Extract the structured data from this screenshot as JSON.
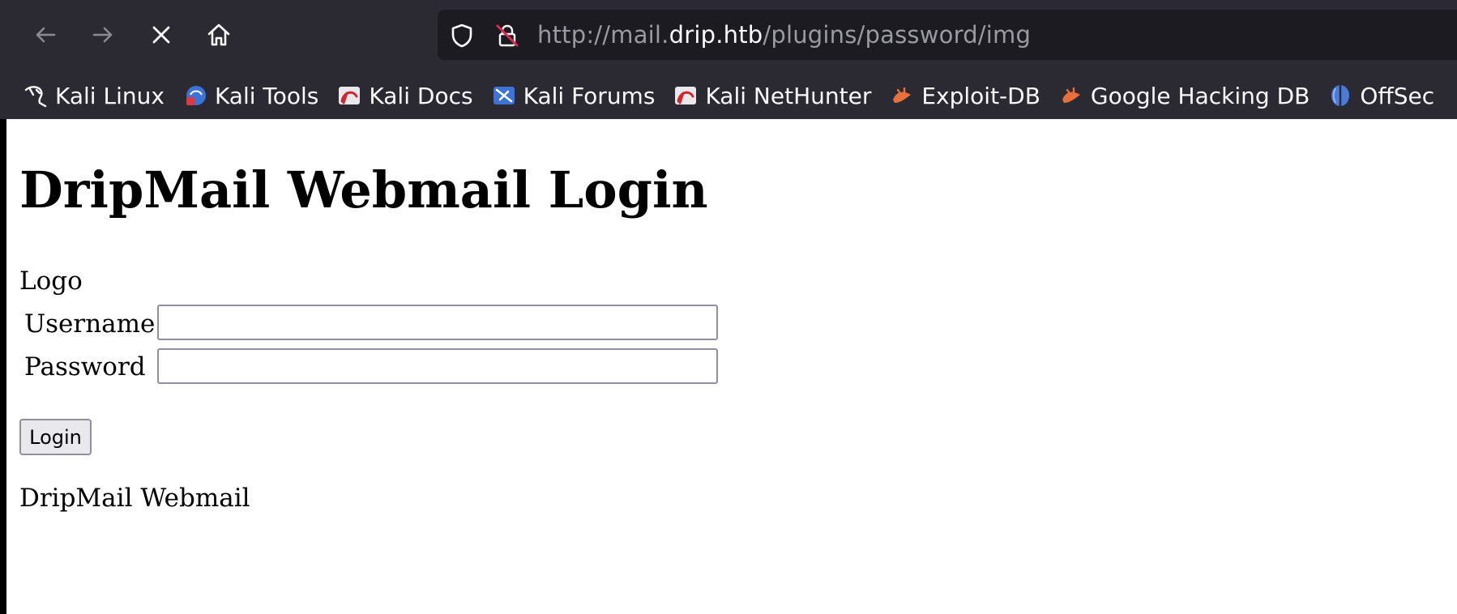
{
  "browser": {
    "url": {
      "scheme": "http://mail.",
      "host": "drip.htb",
      "path": "/plugins/password/img"
    },
    "bookmarks": [
      {
        "label": "Kali Linux",
        "icon": "kali-dragon-icon"
      },
      {
        "label": "Kali Tools",
        "icon": "kali-tools-icon"
      },
      {
        "label": "Kali Docs",
        "icon": "kali-docs-icon"
      },
      {
        "label": "Kali Forums",
        "icon": "kali-forums-icon"
      },
      {
        "label": "Kali NetHunter",
        "icon": "kali-nethunter-icon"
      },
      {
        "label": "Exploit-DB",
        "icon": "exploit-db-icon"
      },
      {
        "label": "Google Hacking DB",
        "icon": "google-hacking-db-icon"
      },
      {
        "label": "OffSec",
        "icon": "offsec-icon"
      }
    ]
  },
  "page": {
    "title": "DripMail Webmail Login",
    "logo_alt": "Logo",
    "username_label": "Username",
    "password_label": "Password",
    "username_value": "",
    "password_value": "",
    "login_label": "Login",
    "footer": "DripMail Webmail"
  },
  "colors": {
    "chrome_bg": "#2b2a33",
    "urlbar_bg": "#1c1b22",
    "page_bg": "#ffffff"
  }
}
